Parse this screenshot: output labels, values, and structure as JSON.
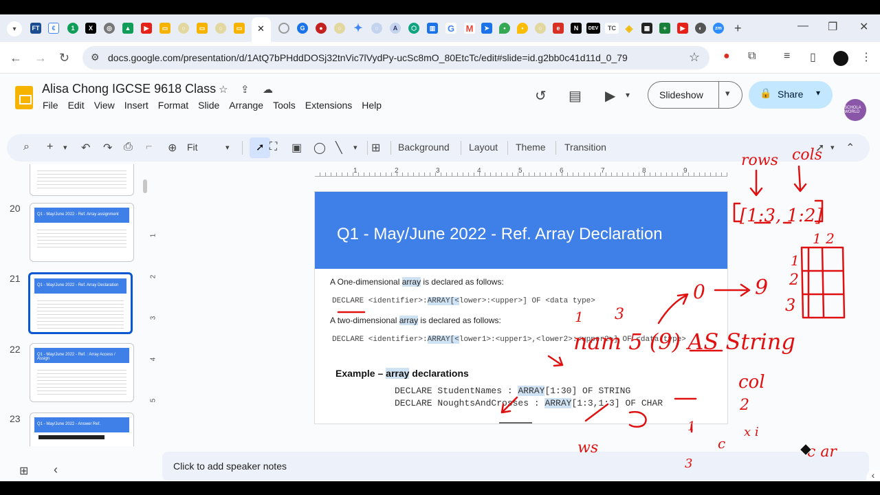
{
  "browser": {
    "url": "docs.google.com/presentation/d/1AtQ7bPHddDOSj32tnVic7lVydPy-ucSc8mO_80EtcTc/edit#slide=id.g2bb0c41d11d_0_79",
    "tab_favicons": [
      "ft-icon",
      "doc-icon",
      "one-icon",
      "x-icon",
      "globe-icon",
      "drive-icon",
      "youtube-icon",
      "slides-icon",
      "chrome-icon",
      "slides-icon",
      "chrome-icon",
      "slides-icon"
    ],
    "tab_close": "✕",
    "new_tab": "+"
  },
  "app": {
    "doc_title": "Alisa Chong IGCSE 9618 Class",
    "menu": [
      "File",
      "Edit",
      "View",
      "Insert",
      "Format",
      "Slide",
      "Arrange",
      "Tools",
      "Extensions",
      "Help"
    ],
    "slideshow_label": "Slideshow",
    "share_label": "Share",
    "avatar_text": "SCHOLA WORLD"
  },
  "toolbar": {
    "zoom": "Fit",
    "background": "Background",
    "layout": "Layout",
    "theme": "Theme",
    "transition": "Transition"
  },
  "filmstrip": {
    "slides": [
      {
        "num": "20",
        "title": "Q1 - May/June 2022 - Ref. Array assignment"
      },
      {
        "num": "21",
        "title": "Q1 - May/June 2022 - Ref. Array Declaration"
      },
      {
        "num": "22",
        "title": "Q1 - May/June 2022 - Ref. : Array Access / Assign"
      },
      {
        "num": "23",
        "title": "Q1 - May/June 2022 - Answer Ref."
      }
    ]
  },
  "ruler": {
    "h": [
      "1",
      "2",
      "3",
      "4",
      "5",
      "6",
      "7",
      "8",
      "9"
    ],
    "v": [
      "1",
      "2",
      "3",
      "4",
      "5"
    ]
  },
  "slide": {
    "title": "Q1 - May/June 2022 - Ref. Array Declaration",
    "one_dim_pre": "A One-dimensional ",
    "one_dim_hl": "array",
    "one_dim_post": " is declared as follows:",
    "one_dim_code_pre": "DECLARE <identifier>:",
    "one_dim_code_hl": "ARRAY[<",
    "one_dim_code_post": "lower>:<upper>] OF <data type>",
    "two_dim_pre": "A ",
    "two_dim_word": "two-dimensional",
    "two_dim_hl": "array",
    "two_dim_post": " is declared as follows:",
    "two_dim_code_pre": "DECLARE <identifier>:",
    "two_dim_code_hl": "ARRAY[<",
    "two_dim_code_post": "lower1>:<upper1>,<lower2>:<upper2>] OF <data type>",
    "example_pre": "Example – ",
    "example_hl": "array",
    "example_post": " declarations",
    "ex1_pre": "DECLARE StudentNames : ",
    "ex1_hl": "ARRAY",
    "ex1_post": "[1:30] OF STRING",
    "ex2_pre": "DECLARE NoughtsAndCrosses : ",
    "ex2_hl": "ARRAY",
    "ex2_post": "[1:3,1:3] OF CHAR"
  },
  "notes": {
    "placeholder": "Click to add speaker notes"
  },
  "annotations": {
    "rows": "rows",
    "cols": "cols",
    "bounds": "[1:3, 1:2]",
    "col_nums": "1 2",
    "row_nums": [
      "1",
      "2",
      "3"
    ],
    "zero": "0",
    "nine": "9",
    "one": "1",
    "three": "3",
    "nam": "nam 5 (9) AS String",
    "col_word": "col",
    "two": "2",
    "ws": "ws",
    "c": "c",
    "xi": "x i",
    "car": "c ar",
    "bottom_one": "1",
    "bottom_three": "3"
  }
}
